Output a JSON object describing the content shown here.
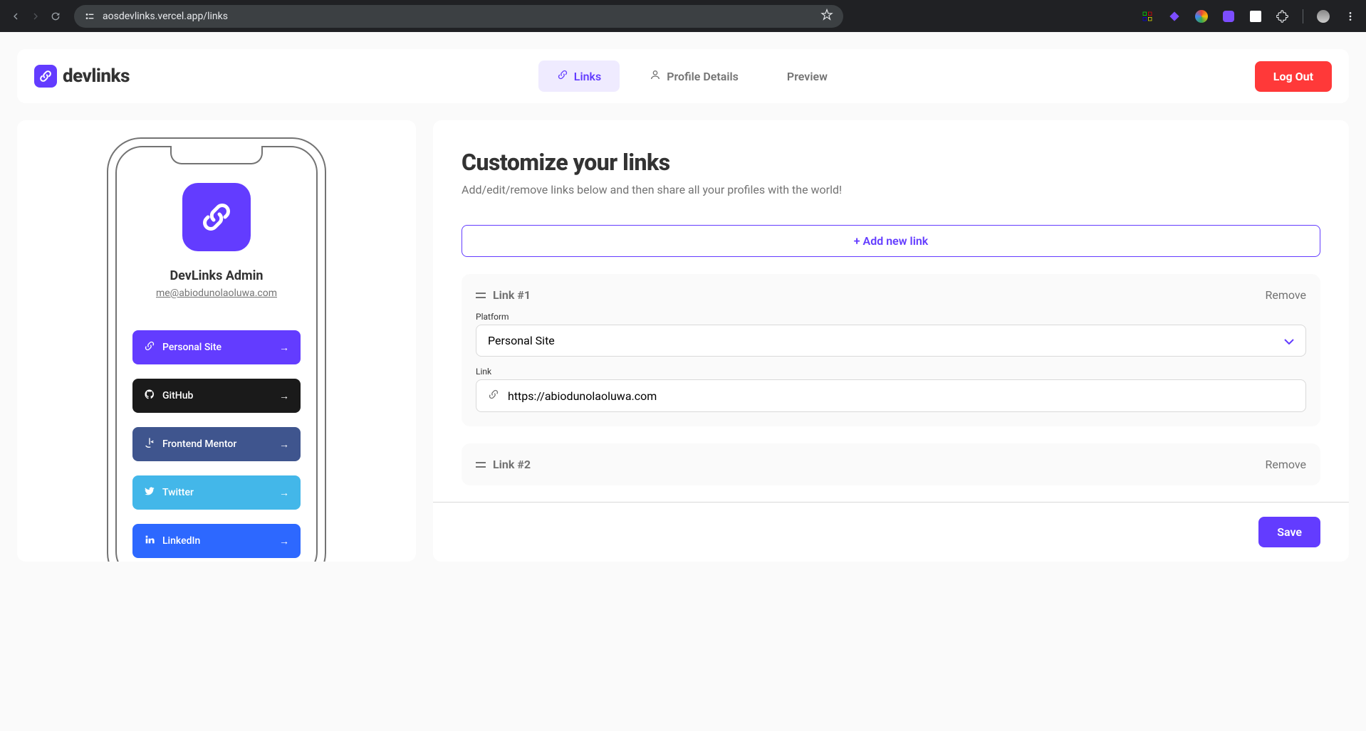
{
  "browser": {
    "url": "aosdevlinks.vercel.app/links"
  },
  "header": {
    "brand": "devlinks",
    "tabs": {
      "links": "Links",
      "profile": "Profile Details",
      "preview": "Preview"
    },
    "logout": "Log Out"
  },
  "preview": {
    "name": "DevLinks Admin",
    "email": "me@abiodunolaoluwa.com",
    "links": [
      {
        "label": "Personal Site"
      },
      {
        "label": "GitHub"
      },
      {
        "label": "Frontend Mentor"
      },
      {
        "label": "Twitter"
      },
      {
        "label": "LinkedIn"
      }
    ]
  },
  "editor": {
    "title": "Customize your links",
    "subtitle": "Add/edit/remove links below and then share all your profiles with the world!",
    "add_button": "+ Add new link",
    "save_button": "Save",
    "platform_label": "Platform",
    "link_label": "Link",
    "remove_label": "Remove",
    "cards": [
      {
        "title": "Link #1",
        "platform": "Personal Site",
        "url": "https://abiodunolaoluwa.com"
      },
      {
        "title": "Link #2"
      }
    ]
  }
}
